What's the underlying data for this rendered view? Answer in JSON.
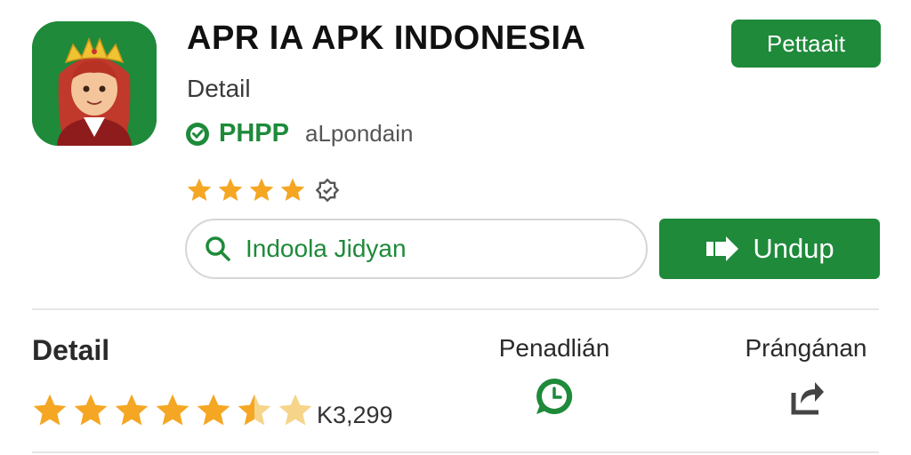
{
  "app": {
    "title": "APR IA APK INDONESIA",
    "subtitle": "Detail",
    "developer": "PHPP",
    "developer_extra": "aLpondain",
    "icon": "app-mascot-icon",
    "small_rating_stars": 4
  },
  "buttons": {
    "install_label": "Pettaait",
    "download_label": "Undup"
  },
  "search": {
    "value": "Indoola Jidyan"
  },
  "details": {
    "heading": "Detail",
    "rating_stars": 5.5,
    "review_count": "K3,299",
    "col1_label": "Penadlián",
    "col2_label": "Prángánan"
  },
  "icons": {
    "verified": "verified-check-icon",
    "extra": "badge-icon",
    "search": "search-icon",
    "download": "download-icon",
    "chat": "whatsapp-chat-icon",
    "share": "share-icon"
  },
  "colors": {
    "brand_green": "#1e8a3a",
    "star": "#f5a623",
    "star_light": "#f6d58a"
  }
}
